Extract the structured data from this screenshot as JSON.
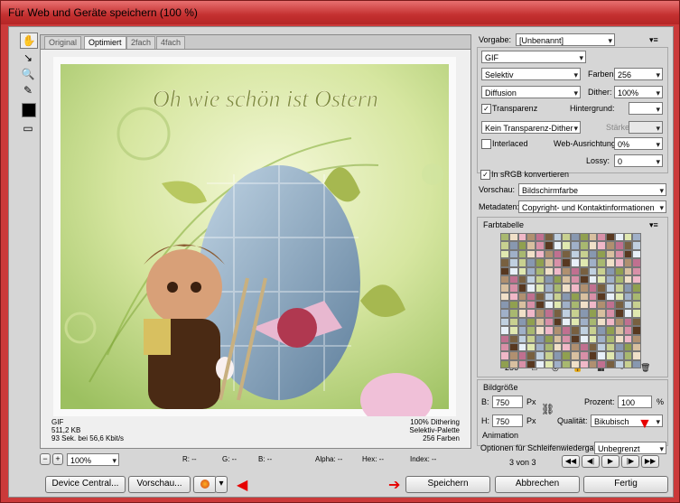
{
  "window": {
    "title": "Für Web und Geräte speichern (100 %)"
  },
  "tabs": [
    "Original",
    "Optimiert",
    "2fach",
    "4fach"
  ],
  "image": {
    "title": "Oh wie schön ist Ostern"
  },
  "info": {
    "left": [
      "GIF",
      "511,2 KB",
      "93 Sek. bei 56,6 Kbit/s"
    ],
    "right": [
      "100% Dithering",
      "Selektiv-Palette",
      "256 Farben"
    ]
  },
  "statusbar": {
    "zoom": "100%",
    "r": "R: --",
    "g": "G: --",
    "b": "B: --",
    "alpha": "Alpha: --",
    "hex": "Hex: --",
    "index": "Index: --"
  },
  "buttons": {
    "device_central": "Device Central...",
    "preview": "Vorschau...",
    "save": "Speichern",
    "cancel": "Abbrechen",
    "done": "Fertig"
  },
  "settings": {
    "preset_label": "Vorgabe:",
    "preset_value": "[Unbenannt]",
    "format": "GIF",
    "reduction": "Selektiv",
    "colors_label": "Farben:",
    "colors_value": "256",
    "dither_algo": "Diffusion",
    "dither_label": "Dither:",
    "dither_value": "100%",
    "transparency": "Transparenz",
    "matte_label": "Hintergrund:",
    "trans_dither": "Kein Transparenz-Dither",
    "amount_label": "Stärke:",
    "interlaced": "Interlaced",
    "websnap_label": "Web-Ausrichtung:",
    "websnap_value": "0%",
    "lossy_label": "Lossy:",
    "lossy_value": "0",
    "srgb": "In sRGB konvertieren",
    "preview_label": "Vorschau:",
    "preview_value": "Bildschirmfarbe",
    "metadata_label": "Metadaten:",
    "metadata_value": "Copyright- und Kontaktinformationen"
  },
  "colortable": {
    "title": "Farbtabelle",
    "count": "256",
    "colors": [
      "#a8b870",
      "#c8d090",
      "#e0e8b0",
      "#786040",
      "#583820",
      "#b09070",
      "#d8c0a0",
      "#f0e0c8",
      "#8898b0",
      "#a0b0c8",
      "#c0d0e0",
      "#e8f0f8",
      "#c07090",
      "#d890a8",
      "#f0b8c8",
      "#90a050"
    ]
  },
  "image_size": {
    "title": "Bildgröße",
    "w_label": "B:",
    "w_value": "750",
    "w_unit": "Px",
    "h_label": "H:",
    "h_value": "750",
    "h_unit": "Px",
    "percent_label": "Prozent:",
    "percent_value": "100",
    "percent_unit": "%",
    "quality_label": "Qualität:",
    "quality_value": "Bikubisch"
  },
  "animation": {
    "title": "Animation",
    "loop_label": "Optionen für Schleifenwiedergabe:",
    "loop_value": "Unbegrenzt",
    "frame": "3 von 3"
  }
}
